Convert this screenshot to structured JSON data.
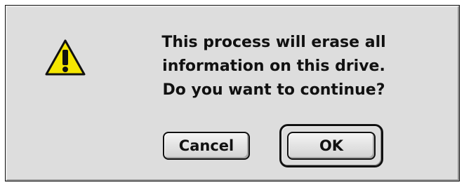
{
  "dialog": {
    "icon": "warning-icon",
    "message_lines": [
      "This process will erase all",
      "information on this drive.",
      "Do you want to continue?"
    ],
    "buttons": {
      "cancel_label": "Cancel",
      "ok_label": "OK"
    }
  },
  "colors": {
    "dialog_background": "#dddddd",
    "warning_fill": "#f5e600",
    "text": "#111111"
  }
}
